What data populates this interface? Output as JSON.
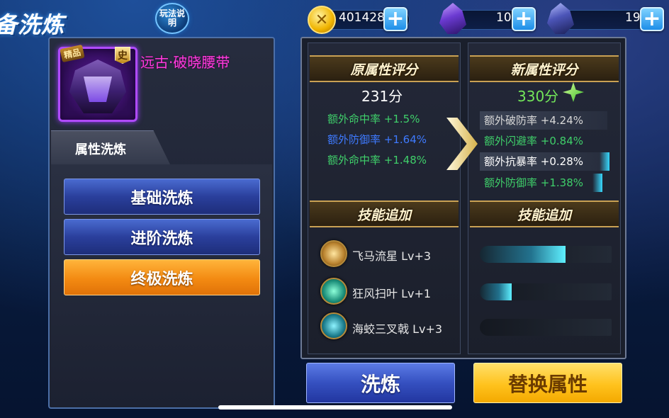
{
  "header": {
    "title": "备洗炼",
    "help_label": "玩法说明",
    "gold_amount": "401428",
    "crystal_1_amount": "10",
    "crystal_2_amount": "19",
    "plus_label": "+"
  },
  "item": {
    "name": "远古·破晓腰带",
    "quality_tag": "精品",
    "rank_badge": "史"
  },
  "left": {
    "tab_label": "属性洗炼",
    "buttons": [
      {
        "label": "基础洗炼"
      },
      {
        "label": "进阶洗炼"
      },
      {
        "label": "终极洗炼"
      }
    ]
  },
  "original": {
    "header": "原属性评分",
    "score": "231分",
    "stats": [
      {
        "name": "额外命中率",
        "value": "+1.5%"
      },
      {
        "name": "额外防御率",
        "value": "+1.64%"
      },
      {
        "name": "额外命中率",
        "value": "+1.48%"
      }
    ],
    "skills_header": "技能追加"
  },
  "new": {
    "header": "新属性评分",
    "score": "330分",
    "stats": [
      {
        "name": "额外破防率",
        "value": "+4.24%"
      },
      {
        "name": "额外闪避率",
        "value": "+0.84%"
      },
      {
        "name": "额外抗暴率",
        "value": "+0.28%"
      },
      {
        "name": "额外防御率",
        "value": "+1.38%"
      }
    ],
    "skills_header": "技能追加"
  },
  "skills": [
    {
      "name": "飞马流星",
      "level": "Lv+3",
      "fill": 0.65
    },
    {
      "name": "狂风扫叶",
      "level": "Lv+1",
      "fill": 0.24
    },
    {
      "name": "海蛟三叉戟",
      "level": "Lv+3",
      "fill": 0.0
    }
  ],
  "actions": {
    "wash_label": "洗炼",
    "replace_label": "替换属性"
  },
  "colors": {
    "item_name": "#ff3bdc",
    "stat_green": "#3fcf6a",
    "stat_blue": "#3e7aff",
    "new_score": "#73e65a",
    "orange_button": "#f38a12",
    "yellow_button": "#ffc21d",
    "blue_button": "#3550c0"
  },
  "icons": {
    "gold": "coin-icon",
    "crystal": "crystal-icon",
    "plus": "plus-icon",
    "arrow": "chevron-right-icon",
    "sparkle": "sparkle-icon"
  }
}
